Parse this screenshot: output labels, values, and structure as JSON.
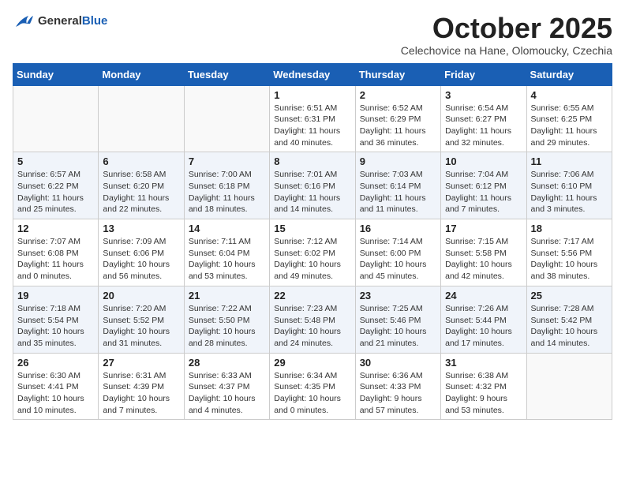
{
  "logo": {
    "general": "General",
    "blue": "Blue"
  },
  "title": "October 2025",
  "subtitle": "Celechovice na Hane, Olomoucky, Czechia",
  "days_of_week": [
    "Sunday",
    "Monday",
    "Tuesday",
    "Wednesday",
    "Thursday",
    "Friday",
    "Saturday"
  ],
  "weeks": [
    [
      {
        "day": "",
        "info": ""
      },
      {
        "day": "",
        "info": ""
      },
      {
        "day": "",
        "info": ""
      },
      {
        "day": "1",
        "info": "Sunrise: 6:51 AM\nSunset: 6:31 PM\nDaylight: 11 hours\nand 40 minutes."
      },
      {
        "day": "2",
        "info": "Sunrise: 6:52 AM\nSunset: 6:29 PM\nDaylight: 11 hours\nand 36 minutes."
      },
      {
        "day": "3",
        "info": "Sunrise: 6:54 AM\nSunset: 6:27 PM\nDaylight: 11 hours\nand 32 minutes."
      },
      {
        "day": "4",
        "info": "Sunrise: 6:55 AM\nSunset: 6:25 PM\nDaylight: 11 hours\nand 29 minutes."
      }
    ],
    [
      {
        "day": "5",
        "info": "Sunrise: 6:57 AM\nSunset: 6:22 PM\nDaylight: 11 hours\nand 25 minutes."
      },
      {
        "day": "6",
        "info": "Sunrise: 6:58 AM\nSunset: 6:20 PM\nDaylight: 11 hours\nand 22 minutes."
      },
      {
        "day": "7",
        "info": "Sunrise: 7:00 AM\nSunset: 6:18 PM\nDaylight: 11 hours\nand 18 minutes."
      },
      {
        "day": "8",
        "info": "Sunrise: 7:01 AM\nSunset: 6:16 PM\nDaylight: 11 hours\nand 14 minutes."
      },
      {
        "day": "9",
        "info": "Sunrise: 7:03 AM\nSunset: 6:14 PM\nDaylight: 11 hours\nand 11 minutes."
      },
      {
        "day": "10",
        "info": "Sunrise: 7:04 AM\nSunset: 6:12 PM\nDaylight: 11 hours\nand 7 minutes."
      },
      {
        "day": "11",
        "info": "Sunrise: 7:06 AM\nSunset: 6:10 PM\nDaylight: 11 hours\nand 3 minutes."
      }
    ],
    [
      {
        "day": "12",
        "info": "Sunrise: 7:07 AM\nSunset: 6:08 PM\nDaylight: 11 hours\nand 0 minutes."
      },
      {
        "day": "13",
        "info": "Sunrise: 7:09 AM\nSunset: 6:06 PM\nDaylight: 10 hours\nand 56 minutes."
      },
      {
        "day": "14",
        "info": "Sunrise: 7:11 AM\nSunset: 6:04 PM\nDaylight: 10 hours\nand 53 minutes."
      },
      {
        "day": "15",
        "info": "Sunrise: 7:12 AM\nSunset: 6:02 PM\nDaylight: 10 hours\nand 49 minutes."
      },
      {
        "day": "16",
        "info": "Sunrise: 7:14 AM\nSunset: 6:00 PM\nDaylight: 10 hours\nand 45 minutes."
      },
      {
        "day": "17",
        "info": "Sunrise: 7:15 AM\nSunset: 5:58 PM\nDaylight: 10 hours\nand 42 minutes."
      },
      {
        "day": "18",
        "info": "Sunrise: 7:17 AM\nSunset: 5:56 PM\nDaylight: 10 hours\nand 38 minutes."
      }
    ],
    [
      {
        "day": "19",
        "info": "Sunrise: 7:18 AM\nSunset: 5:54 PM\nDaylight: 10 hours\nand 35 minutes."
      },
      {
        "day": "20",
        "info": "Sunrise: 7:20 AM\nSunset: 5:52 PM\nDaylight: 10 hours\nand 31 minutes."
      },
      {
        "day": "21",
        "info": "Sunrise: 7:22 AM\nSunset: 5:50 PM\nDaylight: 10 hours\nand 28 minutes."
      },
      {
        "day": "22",
        "info": "Sunrise: 7:23 AM\nSunset: 5:48 PM\nDaylight: 10 hours\nand 24 minutes."
      },
      {
        "day": "23",
        "info": "Sunrise: 7:25 AM\nSunset: 5:46 PM\nDaylight: 10 hours\nand 21 minutes."
      },
      {
        "day": "24",
        "info": "Sunrise: 7:26 AM\nSunset: 5:44 PM\nDaylight: 10 hours\nand 17 minutes."
      },
      {
        "day": "25",
        "info": "Sunrise: 7:28 AM\nSunset: 5:42 PM\nDaylight: 10 hours\nand 14 minutes."
      }
    ],
    [
      {
        "day": "26",
        "info": "Sunrise: 6:30 AM\nSunset: 4:41 PM\nDaylight: 10 hours\nand 10 minutes."
      },
      {
        "day": "27",
        "info": "Sunrise: 6:31 AM\nSunset: 4:39 PM\nDaylight: 10 hours\nand 7 minutes."
      },
      {
        "day": "28",
        "info": "Sunrise: 6:33 AM\nSunset: 4:37 PM\nDaylight: 10 hours\nand 4 minutes."
      },
      {
        "day": "29",
        "info": "Sunrise: 6:34 AM\nSunset: 4:35 PM\nDaylight: 10 hours\nand 0 minutes."
      },
      {
        "day": "30",
        "info": "Sunrise: 6:36 AM\nSunset: 4:33 PM\nDaylight: 9 hours\nand 57 minutes."
      },
      {
        "day": "31",
        "info": "Sunrise: 6:38 AM\nSunset: 4:32 PM\nDaylight: 9 hours\nand 53 minutes."
      },
      {
        "day": "",
        "info": ""
      }
    ]
  ]
}
